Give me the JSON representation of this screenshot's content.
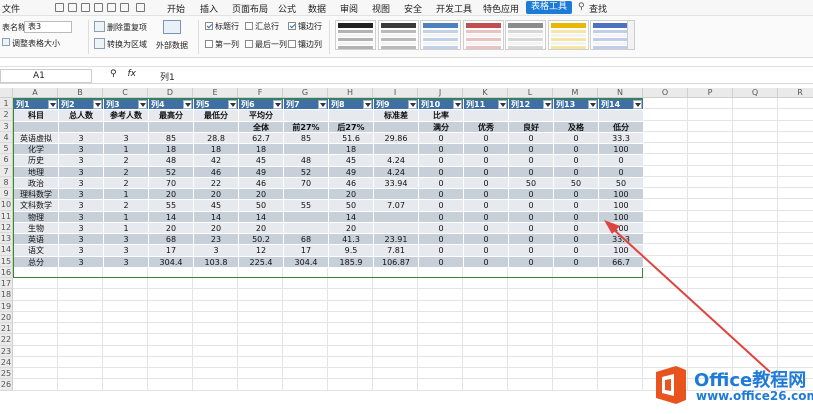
{
  "menu": {
    "file": "文件",
    "tabs": [
      "开始",
      "插入",
      "页面布局",
      "公式",
      "数据",
      "审阅",
      "视图",
      "安全",
      "开发工具",
      "特色应用"
    ],
    "active_tab": "表格工具",
    "search": "查找"
  },
  "ribbon": {
    "table_name_label": "表名称:",
    "table_name_value": "表3",
    "resize_label": "调整表格大小",
    "remove_dup_label": "删除重复项",
    "convert_range_label": "转换为区域",
    "external_data_label": "外部数据",
    "options": [
      {
        "label": "标题行",
        "checked": true
      },
      {
        "label": "汇总行",
        "checked": false
      },
      {
        "label": "镶边行",
        "checked": true
      },
      {
        "label": "第一列",
        "checked": false
      },
      {
        "label": "最后一列",
        "checked": false
      },
      {
        "label": "镶边列",
        "checked": false
      }
    ],
    "style_colors": [
      "#222222",
      "#3a3a3a",
      "#4f81bd",
      "#c0504d",
      "#8c8c8c",
      "#e6b800",
      "#4f6fc0"
    ]
  },
  "formula_bar": {
    "cell_ref": "A1",
    "fx": "fx",
    "value": "列1"
  },
  "sheet": {
    "column_letters": [
      "A",
      "B",
      "C",
      "D",
      "E",
      "F",
      "G",
      "H",
      "I",
      "J",
      "K",
      "L",
      "M",
      "N",
      "O",
      "P",
      "Q",
      "R"
    ],
    "row_numbers": [
      "1",
      "2",
      "3",
      "4",
      "5",
      "6",
      "7",
      "8",
      "9",
      "10",
      "11",
      "12",
      "13",
      "14",
      "15",
      "16",
      "17",
      "18",
      "19",
      "20",
      "21",
      "22",
      "23",
      "24",
      "25",
      "26"
    ],
    "table_headers": [
      "列1",
      "列2",
      "列3",
      "列4",
      "列5",
      "列6",
      "列7",
      "列8",
      "列9",
      "列10",
      "列11",
      "列12",
      "列13",
      "列14"
    ],
    "rows": [
      [
        "科目",
        "总人数",
        "参考人数",
        "最高分",
        "最低分",
        "平均分",
        "",
        "",
        "标准差",
        "比率",
        "",
        "",
        "",
        ""
      ],
      [
        "",
        "",
        "",
        "",
        "",
        "全体",
        "前27%",
        "后27%",
        "",
        "满分",
        "优秀",
        "良好",
        "及格",
        "低分"
      ],
      [
        "英语虚拟",
        "3",
        "3",
        "85",
        "28.8",
        "62.7",
        "85",
        "51.6",
        "29.86",
        "0",
        "0",
        "0",
        "0",
        "33.3"
      ],
      [
        "化学",
        "3",
        "1",
        "18",
        "18",
        "18",
        "",
        "18",
        "",
        "0",
        "0",
        "0",
        "0",
        "100"
      ],
      [
        "历史",
        "3",
        "2",
        "48",
        "42",
        "45",
        "48",
        "45",
        "4.24",
        "0",
        "0",
        "0",
        "0",
        "0"
      ],
      [
        "地理",
        "3",
        "2",
        "52",
        "46",
        "49",
        "52",
        "49",
        "4.24",
        "0",
        "0",
        "0",
        "0",
        "0"
      ],
      [
        "政治",
        "3",
        "2",
        "70",
        "22",
        "46",
        "70",
        "46",
        "33.94",
        "0",
        "0",
        "50",
        "50",
        "50"
      ],
      [
        "理科数学",
        "3",
        "1",
        "20",
        "20",
        "20",
        "",
        "20",
        "",
        "0",
        "0",
        "0",
        "0",
        "100"
      ],
      [
        "文科数学",
        "3",
        "2",
        "55",
        "45",
        "50",
        "55",
        "50",
        "7.07",
        "0",
        "0",
        "0",
        "0",
        "100"
      ],
      [
        "物理",
        "3",
        "1",
        "14",
        "14",
        "14",
        "",
        "14",
        "",
        "0",
        "0",
        "0",
        "0",
        "100"
      ],
      [
        "生物",
        "3",
        "1",
        "20",
        "20",
        "20",
        "",
        "20",
        "",
        "0",
        "0",
        "0",
        "0",
        "100"
      ],
      [
        "英语",
        "3",
        "3",
        "68",
        "23",
        "50.2",
        "68",
        "41.3",
        "23.91",
        "0",
        "0",
        "0",
        "0",
        "33.3"
      ],
      [
        "语文",
        "3",
        "3",
        "17",
        "3",
        "12",
        "17",
        "9.5",
        "7.81",
        "0",
        "0",
        "0",
        "0",
        "100"
      ],
      [
        "总分",
        "3",
        "3",
        "304.4",
        "103.8",
        "225.4",
        "304.4",
        "185.9",
        "106.87",
        "0",
        "0",
        "0",
        "0",
        "66.7"
      ]
    ]
  },
  "watermark": {
    "name": "Office教程网",
    "site": "www.office26.com"
  }
}
